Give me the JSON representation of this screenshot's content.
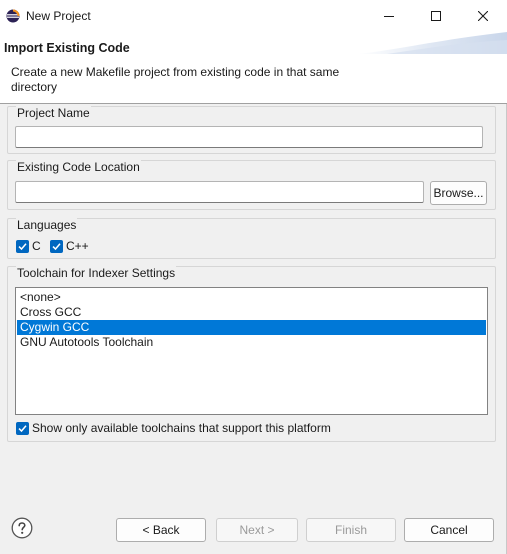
{
  "window": {
    "title": "New Project",
    "controls": {
      "minimize": "minimize-icon",
      "maximize": "maximize-icon",
      "close": "close-icon"
    }
  },
  "banner": {
    "title": "Import Existing Code",
    "description": "Create a new Makefile project from existing code in that same directory"
  },
  "project_name": {
    "label": "Project Name",
    "value": ""
  },
  "code_location": {
    "label": "Existing Code Location",
    "value": "",
    "browse_label": "Browse..."
  },
  "languages": {
    "label": "Languages",
    "items": [
      {
        "label": "C",
        "checked": true
      },
      {
        "label": "C++",
        "checked": true
      }
    ]
  },
  "toolchain": {
    "label": "Toolchain for Indexer Settings",
    "items": [
      "<none>",
      "Cross GCC",
      "Cygwin GCC",
      "GNU Autotools Toolchain"
    ],
    "selected": "Cygwin GCC",
    "filter_label": "Show only available toolchains that support this platform",
    "filter_checked": true
  },
  "footer": {
    "help_icon": "help-icon",
    "back_label": "< Back",
    "next_label": "Next >",
    "finish_label": "Finish",
    "cancel_label": "Cancel"
  },
  "colors": {
    "accent": "#0067c0",
    "selection": "#0078d7",
    "eclipse_purple": "#2c2255",
    "eclipse_orange": "#f7941e"
  }
}
